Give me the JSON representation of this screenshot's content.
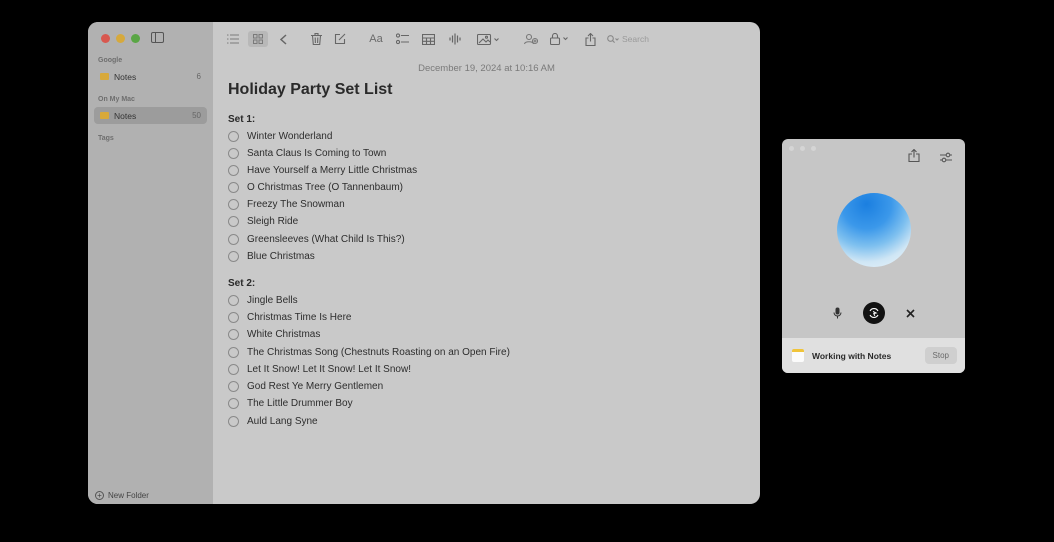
{
  "sidebar": {
    "sections": [
      {
        "label": "Google",
        "folders": [
          {
            "name": "Notes",
            "count": "6",
            "selected": false
          }
        ]
      },
      {
        "label": "On My Mac",
        "folders": [
          {
            "name": "Notes",
            "count": "50",
            "selected": true
          }
        ]
      },
      {
        "label": "Tags",
        "folders": []
      }
    ],
    "new_folder_label": "New Folder"
  },
  "toolbar": {
    "search_placeholder": "Search"
  },
  "note": {
    "date": "December 19, 2024 at 10:16 AM",
    "title": "Holiday Party Set List",
    "sets": [
      {
        "heading": "Set 1:",
        "items": [
          "Winter Wonderland",
          "Santa Claus Is Coming to Town",
          "Have Yourself a Merry Little Christmas",
          "O Christmas Tree (O Tannenbaum)",
          "Freezy The Snowman",
          "Sleigh Ride",
          "Greensleeves (What Child Is This?)",
          "Blue Christmas"
        ]
      },
      {
        "heading": "Set 2:",
        "items": [
          "Jingle Bells",
          "Christmas Time Is Here",
          "White Christmas",
          "The Christmas Song (Chestnuts Roasting on an Open Fire)",
          "Let It Snow! Let It Snow! Let It Snow!",
          "God Rest Ye Merry Gentlemen",
          "The Little Drummer Boy",
          "Auld Lang Syne"
        ]
      }
    ]
  },
  "assistant_panel": {
    "status_text": "Working with Notes",
    "stop_label": "Stop",
    "orb_colors": [
      "#1b7fe0",
      "#7ec0ef",
      "#eef6fb"
    ]
  }
}
